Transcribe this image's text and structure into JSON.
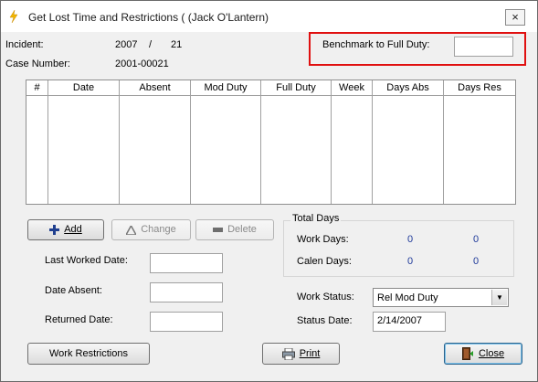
{
  "window": {
    "title": "Get Lost Time and Restrictions ( (Jack O'Lantern)",
    "close_glyph": "×"
  },
  "header": {
    "incident_label": "Incident:",
    "incident_year": "2007",
    "incident_sep": "/",
    "incident_num": "21",
    "case_label": "Case Number:",
    "case_value": "2001-00021",
    "benchmark_label": "Benchmark to Full Duty:",
    "benchmark_value": ""
  },
  "grid": {
    "columns": [
      "#",
      "Date",
      "Absent",
      "Mod Duty",
      "Full Duty",
      "Week",
      "Days Abs",
      "Days Res"
    ],
    "rows": []
  },
  "buttons": {
    "add": "Add",
    "change": "Change",
    "delete": "Delete",
    "work_restrictions": "Work Restrictions",
    "print": "Print",
    "close": "Close"
  },
  "dates": {
    "last_worked_label": "Last Worked Date:",
    "last_worked_value": "",
    "absent_label": "Date Absent:",
    "absent_value": "",
    "returned_label": "Returned Date:",
    "returned_value": ""
  },
  "totals": {
    "title": "Total Days",
    "work_days_label": "Work Days:",
    "work_days_a": "0",
    "work_days_b": "0",
    "calen_days_label": "Calen Days:",
    "calen_days_a": "0",
    "calen_days_b": "0"
  },
  "status": {
    "work_status_label": "Work Status:",
    "work_status_value": "Rel Mod Duty",
    "status_date_label": "Status Date:",
    "status_date_value": "2/14/2007"
  },
  "icons": {
    "title": "lightning-icon",
    "add": "plus-icon",
    "change": "triangle-icon",
    "delete": "minus-icon",
    "print": "printer-icon",
    "close": "exit-door-icon",
    "dropdown": "chevron-down-icon"
  }
}
